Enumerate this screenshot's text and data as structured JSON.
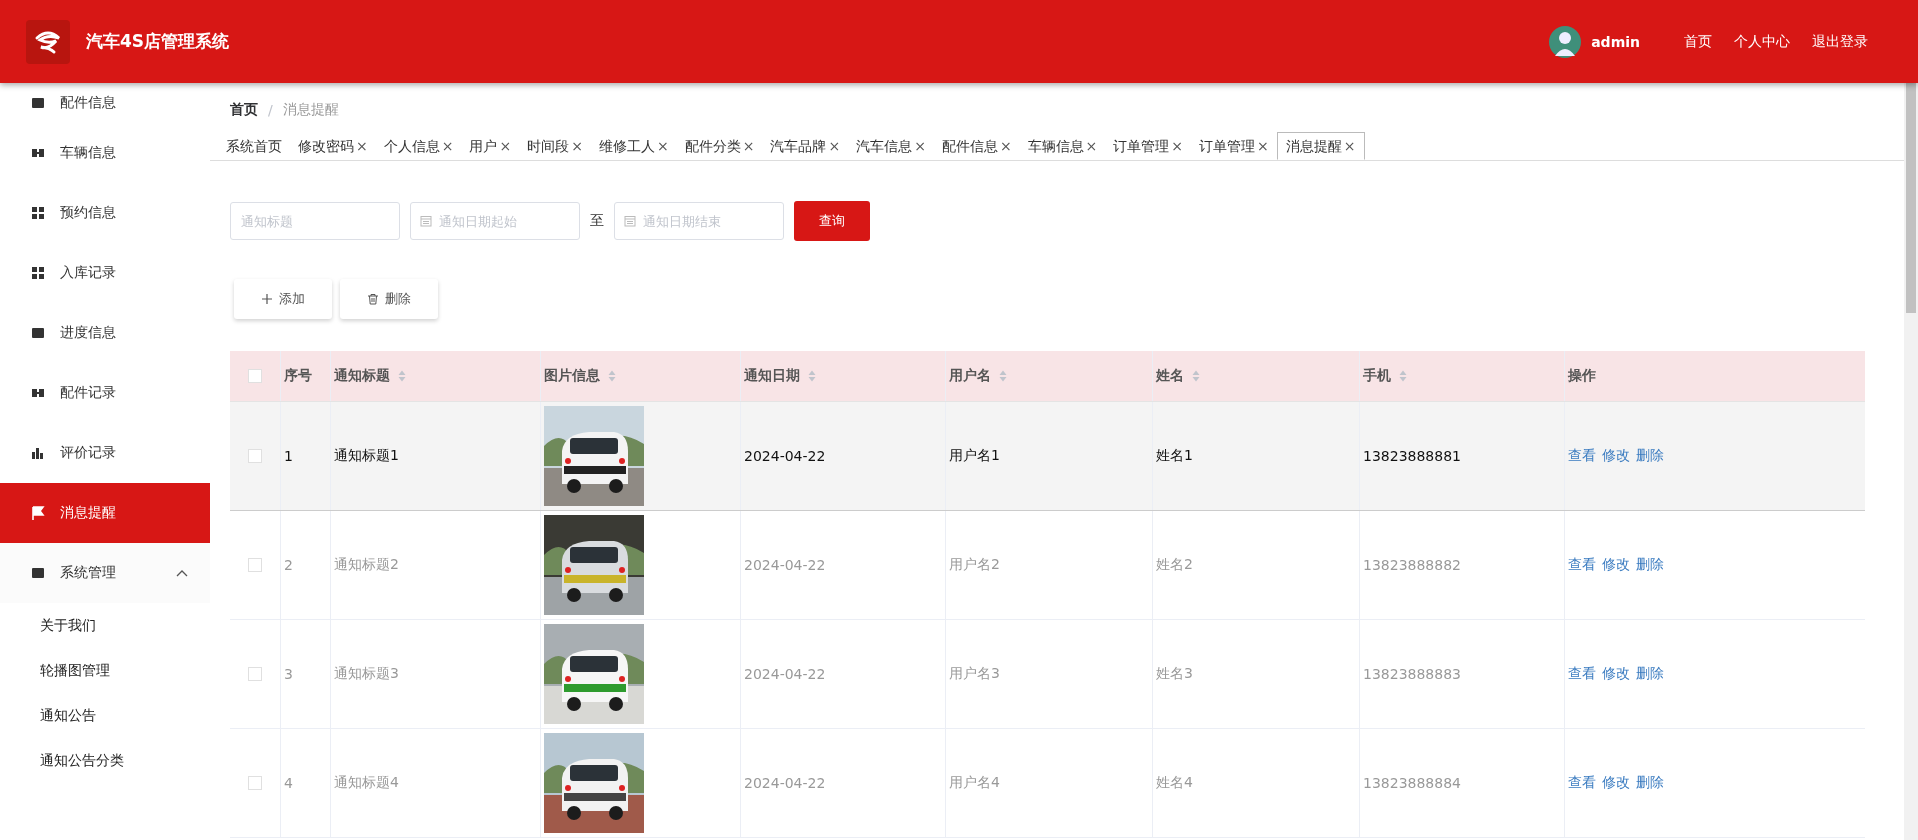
{
  "header": {
    "title": "汽车4S店管理系统",
    "user": "admin",
    "links": [
      "首页",
      "个人中心",
      "退出登录"
    ]
  },
  "sidebar": {
    "items": [
      {
        "label": "配件信息",
        "selected": false
      },
      {
        "label": "车辆信息",
        "selected": false
      },
      {
        "label": "预约信息",
        "selected": false
      },
      {
        "label": "入库记录",
        "selected": false
      },
      {
        "label": "进度信息",
        "selected": false
      },
      {
        "label": "配件记录",
        "selected": false
      },
      {
        "label": "评价记录",
        "selected": false
      },
      {
        "label": "消息提醒",
        "selected": true
      },
      {
        "label": "系统管理",
        "selected": false,
        "expanded": true,
        "children": [
          {
            "label": "关于我们"
          },
          {
            "label": "轮播图管理"
          },
          {
            "label": "通知公告"
          },
          {
            "label": "通知公告分类"
          }
        ]
      }
    ]
  },
  "breadcrumb": {
    "items": [
      "首页",
      "消息提醒"
    ],
    "separator": "/"
  },
  "tabs": [
    {
      "label": "系统首页",
      "selected": false
    },
    {
      "label": "修改密码",
      "close": "×",
      "selected": false
    },
    {
      "label": "个人信息",
      "close": "×",
      "selected": false
    },
    {
      "label": "用户",
      "close": "×",
      "selected": false
    },
    {
      "label": "时间段",
      "close": "×",
      "selected": false
    },
    {
      "label": "维修工人",
      "close": "×",
      "selected": false
    },
    {
      "label": "配件分类",
      "close": "×",
      "selected": false
    },
    {
      "label": "汽车品牌",
      "close": "×",
      "selected": false
    },
    {
      "label": "汽车信息",
      "close": "×",
      "selected": false
    },
    {
      "label": "配件信息",
      "close": "×",
      "selected": false
    },
    {
      "label": "车辆信息",
      "close": "×",
      "selected": false
    },
    {
      "label": "订单管理",
      "close": "×",
      "selected": false
    },
    {
      "label": "订单管理",
      "close": "×",
      "selected": false
    },
    {
      "label": "消息提醒",
      "close": "×",
      "selected": true
    }
  ],
  "search": {
    "fields": [
      {
        "kind": "text",
        "placeholder": "通知标题"
      },
      {
        "kind": "date",
        "placeholder": "通知日期起始"
      },
      {
        "kind": "separator",
        "label": "至"
      },
      {
        "kind": "date",
        "placeholder": "通知日期结束"
      }
    ],
    "button": "查询"
  },
  "actions": [
    {
      "kind": "add",
      "label": "添加"
    },
    {
      "kind": "delete",
      "label": "删除"
    }
  ],
  "table": {
    "all_checked": false,
    "columns": [
      {
        "label": "序号",
        "sortable": false
      },
      {
        "label": "通知标题",
        "sortable": true
      },
      {
        "label": "图片信息",
        "sortable": true
      },
      {
        "label": "通知日期",
        "sortable": true
      },
      {
        "label": "用户名",
        "sortable": true
      },
      {
        "label": "姓名",
        "sortable": true
      },
      {
        "label": "手机",
        "sortable": true
      },
      {
        "label": "操作",
        "sortable": false
      }
    ],
    "rows": [
      {
        "highlighted": true,
        "checked": false,
        "index": "1",
        "title": "通知标题1",
        "picture": {
          "kind": "picture"
        },
        "date": "2024-04-22",
        "username": "用户名1",
        "name": "姓名1",
        "phone": "13823888881",
        "actions": [
          "查看",
          "修改",
          "删除"
        ]
      },
      {
        "highlighted": false,
        "checked": false,
        "index": "2",
        "title": "通知标题2",
        "picture": {
          "kind": "picture"
        },
        "date": "2024-04-22",
        "username": "用户名2",
        "name": "姓名2",
        "phone": "13823888882",
        "actions": [
          "查看",
          "修改",
          "删除"
        ]
      },
      {
        "highlighted": false,
        "checked": false,
        "index": "3",
        "title": "通知标题3",
        "picture": {
          "kind": "picture"
        },
        "date": "2024-04-22",
        "username": "用户名3",
        "name": "姓名3",
        "phone": "13823888883",
        "actions": [
          "查看",
          "修改",
          "删除"
        ]
      },
      {
        "highlighted": false,
        "checked": false,
        "index": "4",
        "title": "通知标题4",
        "picture": {
          "kind": "picture"
        },
        "date": "2024-04-22",
        "username": "用户名4",
        "name": "姓名4",
        "phone": "13823888884",
        "actions": [
          "查看",
          "修改",
          "删除"
        ]
      }
    ]
  }
}
